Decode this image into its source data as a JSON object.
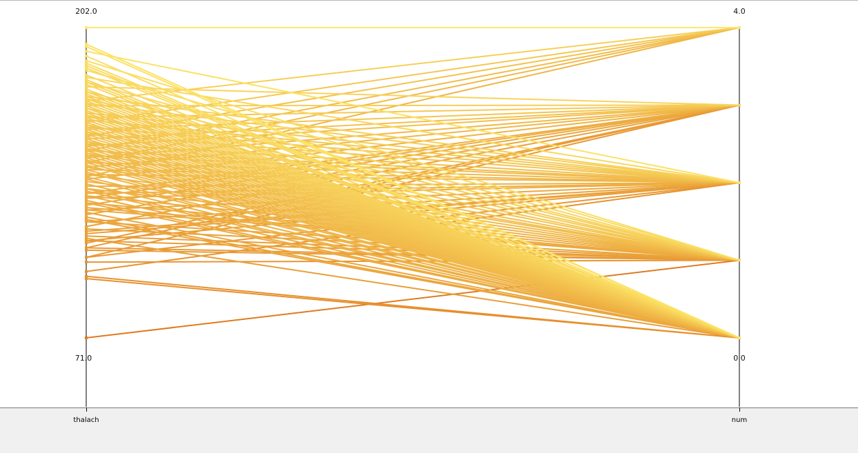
{
  "chart_data": {
    "type": "parallel_coordinates",
    "axes": [
      {
        "name": "thalach",
        "max_label": "202.0",
        "min_label": "71.0",
        "range": [
          71,
          202
        ]
      },
      {
        "name": "num",
        "max_label": "4.0",
        "min_label": "0.0",
        "range": [
          0,
          4
        ]
      }
    ],
    "colors": {
      "low": "#e07a1e",
      "high": "#fde96a",
      "axis": "#000000"
    },
    "color_by": "thalach",
    "records": [
      [
        71,
        1
      ],
      [
        96,
        0
      ],
      [
        97,
        0
      ],
      [
        99,
        2
      ],
      [
        103,
        1
      ],
      [
        105,
        2
      ],
      [
        105,
        3
      ],
      [
        108,
        1
      ],
      [
        109,
        3
      ],
      [
        109,
        1
      ],
      [
        111,
        3
      ],
      [
        112,
        1
      ],
      [
        112,
        2
      ],
      [
        113,
        0
      ],
      [
        114,
        1
      ],
      [
        115,
        2
      ],
      [
        116,
        2
      ],
      [
        117,
        1
      ],
      [
        118,
        3
      ],
      [
        120,
        2
      ],
      [
        120,
        1
      ],
      [
        121,
        0
      ],
      [
        122,
        0
      ],
      [
        123,
        3
      ],
      [
        124,
        0
      ],
      [
        125,
        2
      ],
      [
        125,
        1
      ],
      [
        126,
        1
      ],
      [
        127,
        3
      ],
      [
        128,
        1
      ],
      [
        128,
        0
      ],
      [
        129,
        0
      ],
      [
        130,
        3
      ],
      [
        130,
        2
      ],
      [
        131,
        0
      ],
      [
        131,
        1
      ],
      [
        132,
        2
      ],
      [
        132,
        3
      ],
      [
        133,
        0
      ],
      [
        134,
        1
      ],
      [
        134,
        0
      ],
      [
        135,
        2
      ],
      [
        136,
        0
      ],
      [
        137,
        1
      ],
      [
        138,
        3
      ],
      [
        138,
        0
      ],
      [
        139,
        4
      ],
      [
        139,
        0
      ],
      [
        140,
        2
      ],
      [
        140,
        1
      ],
      [
        141,
        0
      ],
      [
        142,
        2
      ],
      [
        142,
        0
      ],
      [
        143,
        3
      ],
      [
        143,
        1
      ],
      [
        144,
        0
      ],
      [
        145,
        4
      ],
      [
        145,
        2
      ],
      [
        145,
        0
      ],
      [
        146,
        1
      ],
      [
        146,
        0
      ],
      [
        147,
        3
      ],
      [
        147,
        0
      ],
      [
        148,
        2
      ],
      [
        148,
        0
      ],
      [
        149,
        1
      ],
      [
        149,
        0
      ],
      [
        150,
        4
      ],
      [
        150,
        2
      ],
      [
        150,
        0
      ],
      [
        151,
        1
      ],
      [
        151,
        0
      ],
      [
        152,
        3
      ],
      [
        152,
        0
      ],
      [
        153,
        2
      ],
      [
        153,
        0
      ],
      [
        154,
        1
      ],
      [
        154,
        0
      ],
      [
        155,
        3
      ],
      [
        155,
        0
      ],
      [
        156,
        4
      ],
      [
        156,
        0
      ],
      [
        157,
        2
      ],
      [
        157,
        0
      ],
      [
        158,
        1
      ],
      [
        158,
        0
      ],
      [
        159,
        3
      ],
      [
        159,
        0
      ],
      [
        160,
        2
      ],
      [
        160,
        0
      ],
      [
        161,
        1
      ],
      [
        161,
        0
      ],
      [
        162,
        4
      ],
      [
        162,
        0
      ],
      [
        163,
        2
      ],
      [
        163,
        0
      ],
      [
        164,
        3
      ],
      [
        164,
        0
      ],
      [
        165,
        1
      ],
      [
        165,
        0
      ],
      [
        166,
        2
      ],
      [
        166,
        0
      ],
      [
        167,
        0
      ],
      [
        168,
        1
      ],
      [
        168,
        0
      ],
      [
        169,
        3
      ],
      [
        169,
        0
      ],
      [
        170,
        2
      ],
      [
        170,
        0
      ],
      [
        171,
        4
      ],
      [
        171,
        0
      ],
      [
        172,
        1
      ],
      [
        172,
        0
      ],
      [
        173,
        2
      ],
      [
        173,
        0
      ],
      [
        174,
        0
      ],
      [
        175,
        1
      ],
      [
        175,
        0
      ],
      [
        176,
        0
      ],
      [
        177,
        3
      ],
      [
        178,
        0
      ],
      [
        179,
        1
      ],
      [
        179,
        0
      ],
      [
        180,
        0
      ],
      [
        181,
        2
      ],
      [
        182,
        0
      ],
      [
        184,
        1
      ],
      [
        185,
        0
      ],
      [
        186,
        0
      ],
      [
        187,
        0
      ],
      [
        188,
        1
      ],
      [
        190,
        0
      ],
      [
        192,
        2
      ],
      [
        194,
        0
      ],
      [
        195,
        0
      ],
      [
        202,
        4
      ]
    ]
  }
}
